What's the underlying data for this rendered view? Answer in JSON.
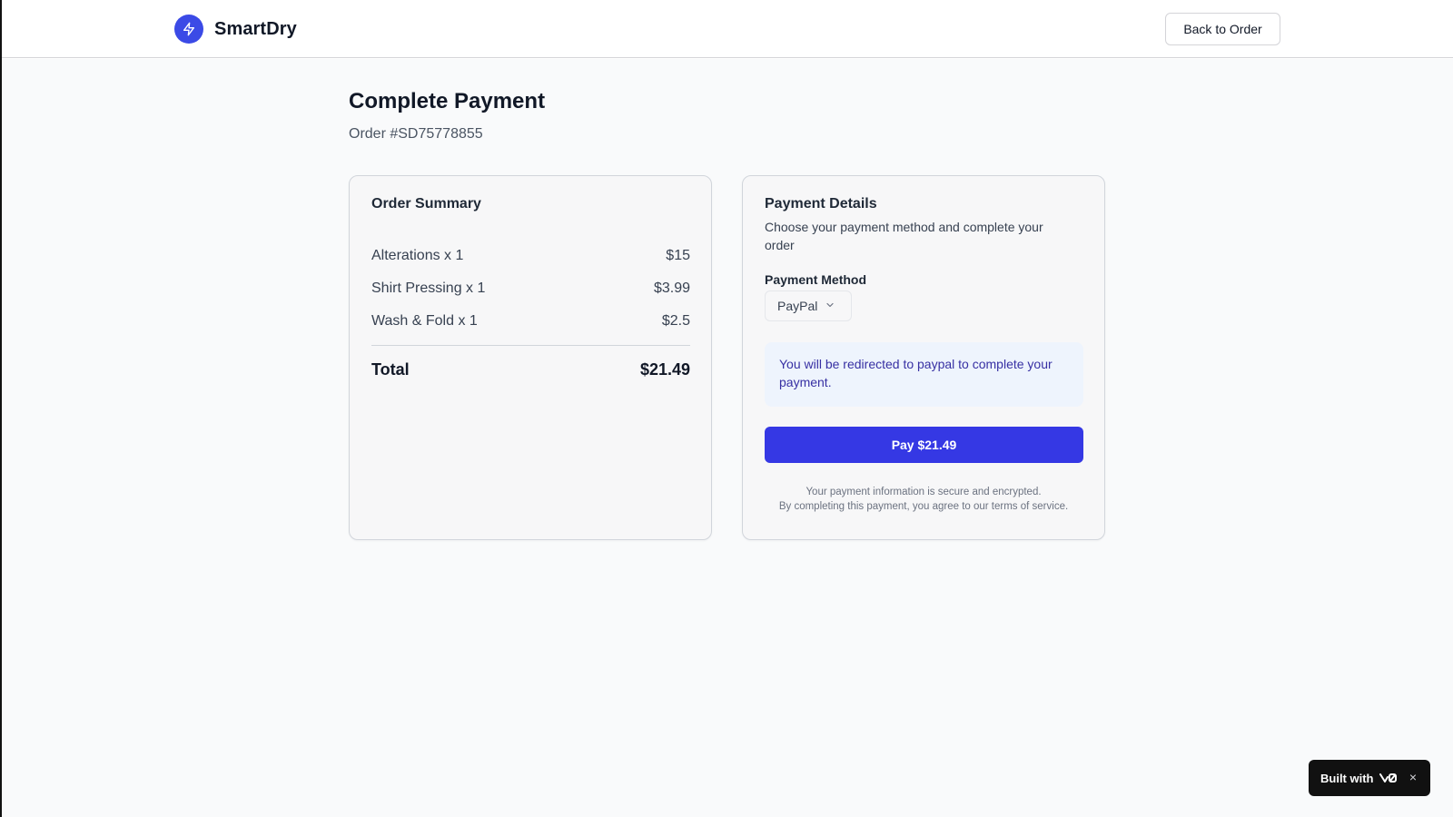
{
  "header": {
    "brand_name": "SmartDry",
    "brand_icon": "lightning-bolt-icon",
    "back_button": "Back to Order"
  },
  "page": {
    "title": "Complete Payment",
    "order_id": "Order #SD75778855"
  },
  "order_summary": {
    "title": "Order Summary",
    "items": [
      {
        "label": "Alterations x 1",
        "price": "$15"
      },
      {
        "label": "Shirt Pressing x 1",
        "price": "$3.99"
      },
      {
        "label": "Wash & Fold x 1",
        "price": "$2.5"
      }
    ],
    "total_label": "Total",
    "total_value": "$21.49"
  },
  "payment": {
    "title": "Payment Details",
    "description": "Choose your payment method and complete your order",
    "method_label": "Payment Method",
    "method_value": "PayPal",
    "notice": "You will be redirected to paypal to complete your payment.",
    "pay_button": "Pay $21.49",
    "secure_line_1": "Your payment information is secure and encrypted.",
    "secure_line_2": "By completing this payment, you agree to our terms of service."
  },
  "badge": {
    "label": "Built with",
    "close": "×"
  },
  "colors": {
    "accent": "#3538e4",
    "brand_logo": "#3b4ae6",
    "notice_bg": "#eef4fd",
    "notice_text": "#3730a3"
  }
}
